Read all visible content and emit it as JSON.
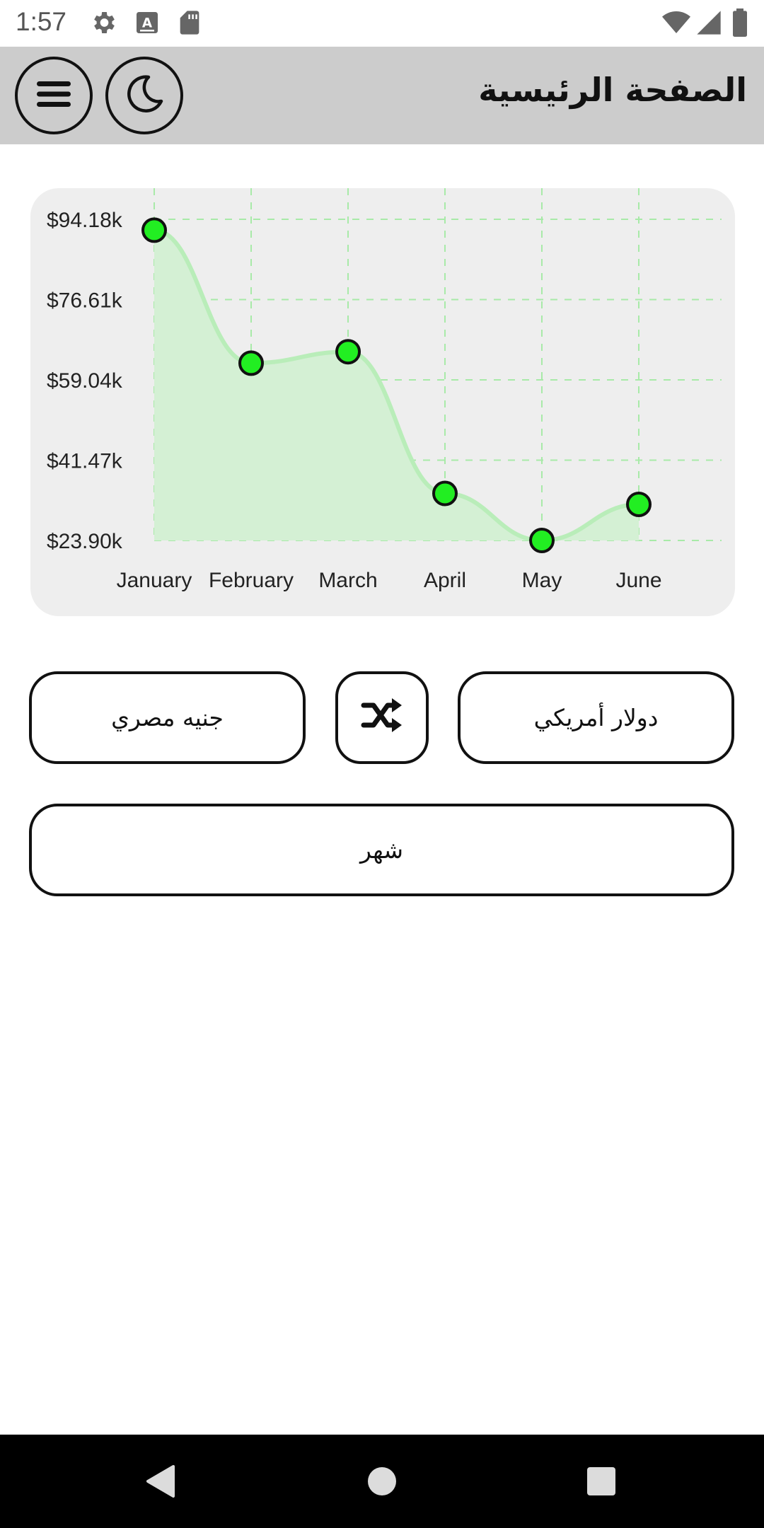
{
  "status_bar": {
    "time": "1:57",
    "icons": [
      "gear-icon",
      "a-icon",
      "sd-card-icon",
      "wifi-icon",
      "signal-icon",
      "battery-icon"
    ]
  },
  "app_bar": {
    "title": "الصفحة الرئيسية",
    "menu_icon": "menu-icon",
    "theme_icon": "moon-icon",
    "background": "#cccccc"
  },
  "chart_data": {
    "type": "area",
    "categories": [
      "January",
      "February",
      "March",
      "April",
      "May",
      "June"
    ],
    "values": [
      91800,
      62700,
      65200,
      34200,
      23900,
      31800
    ],
    "ylim": [
      23900,
      94180
    ],
    "yticks": [
      "$23.90k",
      "$41.47k",
      "$59.04k",
      "$76.61k",
      "$94.18k"
    ],
    "grid": true,
    "line_color": "#b9edb9",
    "fill_color": "#d4f0d4",
    "marker_color": "#22ee22"
  },
  "converter": {
    "from_currency": "دولار أمريكي",
    "to_currency": "جنيه مصري",
    "swap_icon": "shuffle-icon",
    "period": "شهر"
  },
  "nav_bar": {
    "icons": [
      "back-icon",
      "home-icon",
      "recents-icon"
    ]
  }
}
